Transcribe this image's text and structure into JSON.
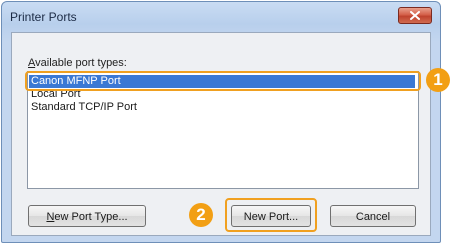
{
  "window": {
    "title": "Printer Ports"
  },
  "label": {
    "accel": "A",
    "rest": "vailable port types:"
  },
  "ports": [
    "Canon MFNP Port",
    "Local Port",
    "Standard TCP/IP Port"
  ],
  "selected_port": "Canon MFNP Port",
  "buttons": {
    "new_port_type": {
      "accel": "N",
      "rest": "ew Port Type..."
    },
    "new_port": "New Port...",
    "cancel": "Cancel"
  },
  "callouts": [
    "1",
    "2"
  ],
  "colors": {
    "highlight": "#f0a020",
    "callout": "#f29f14",
    "selection": "#3a78d4"
  },
  "icons": {
    "close": "close-icon"
  }
}
